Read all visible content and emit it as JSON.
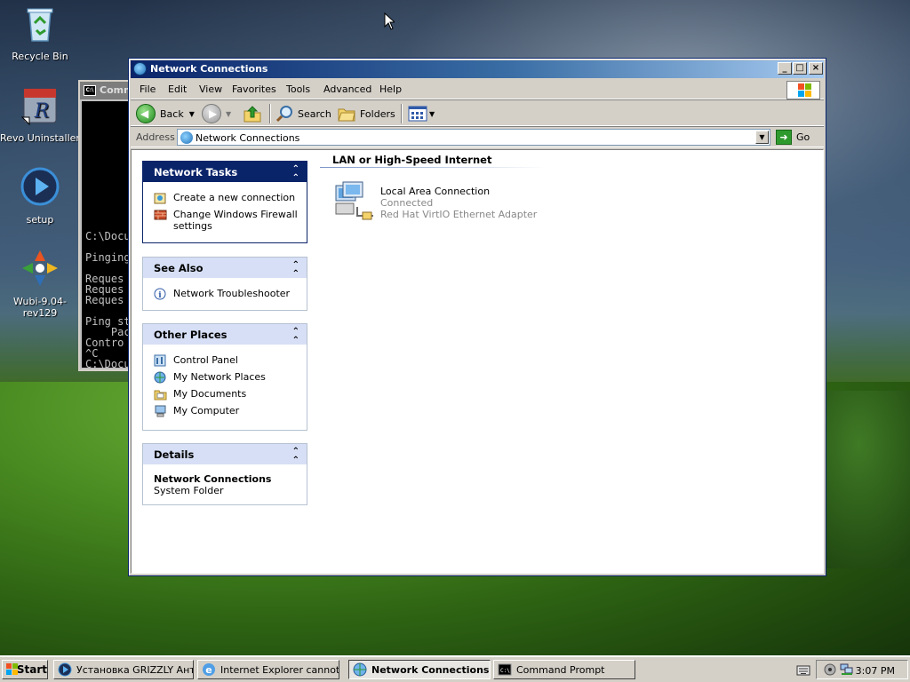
{
  "desktop": {
    "icons": [
      {
        "label": "Recycle Bin",
        "icon": "recycle-bin-icon"
      },
      {
        "label": "Revo Uninstaller",
        "icon": "revo-uninstaller-icon"
      },
      {
        "label": "setup",
        "icon": "setup-icon"
      },
      {
        "label": "Wubi-9.04-rev129",
        "icon": "wubi-icon"
      }
    ]
  },
  "cmd_window": {
    "title": "Comm",
    "lines": [
      "C:\\Docu",
      "Pinging",
      "Reques",
      "Reques",
      "Reques",
      "Ping st",
      "    Pac",
      "Contro",
      "^C",
      "C:\\Docu"
    ]
  },
  "window": {
    "title": "Network Connections",
    "menu": [
      "File",
      "Edit",
      "View",
      "Favorites",
      "Tools",
      "Advanced",
      "Help"
    ],
    "toolbar": {
      "back": "Back",
      "search": "Search",
      "folders": "Folders"
    },
    "address": {
      "label": "Address",
      "value": "Network Connections",
      "go": "Go"
    }
  },
  "panes": {
    "network_tasks": {
      "title": "Network Tasks",
      "items": [
        "Create a new connection",
        "Change Windows Firewall settings"
      ]
    },
    "see_also": {
      "title": "See Also",
      "items": [
        "Network Troubleshooter"
      ]
    },
    "other_places": {
      "title": "Other Places",
      "items": [
        "Control Panel",
        "My Network Places",
        "My Documents",
        "My Computer"
      ]
    },
    "details": {
      "title": "Details",
      "name": "Network Connections",
      "type": "System Folder"
    }
  },
  "main": {
    "section": "LAN or High-Speed Internet",
    "connection": {
      "name": "Local Area Connection",
      "status": "Connected",
      "adapter": "Red Hat VirtIO Ethernet Adapter"
    }
  },
  "taskbar": {
    "start": "Start",
    "tasks": [
      "Установка GRIZZLY Ант...",
      "Internet Explorer cannot...",
      "Network Connections",
      "Command Prompt"
    ],
    "clock": "3:07 PM"
  },
  "colors": {
    "title_active": "#0a246a",
    "pane_header": "#d6dff5",
    "window_face": "#d4d0c8"
  }
}
